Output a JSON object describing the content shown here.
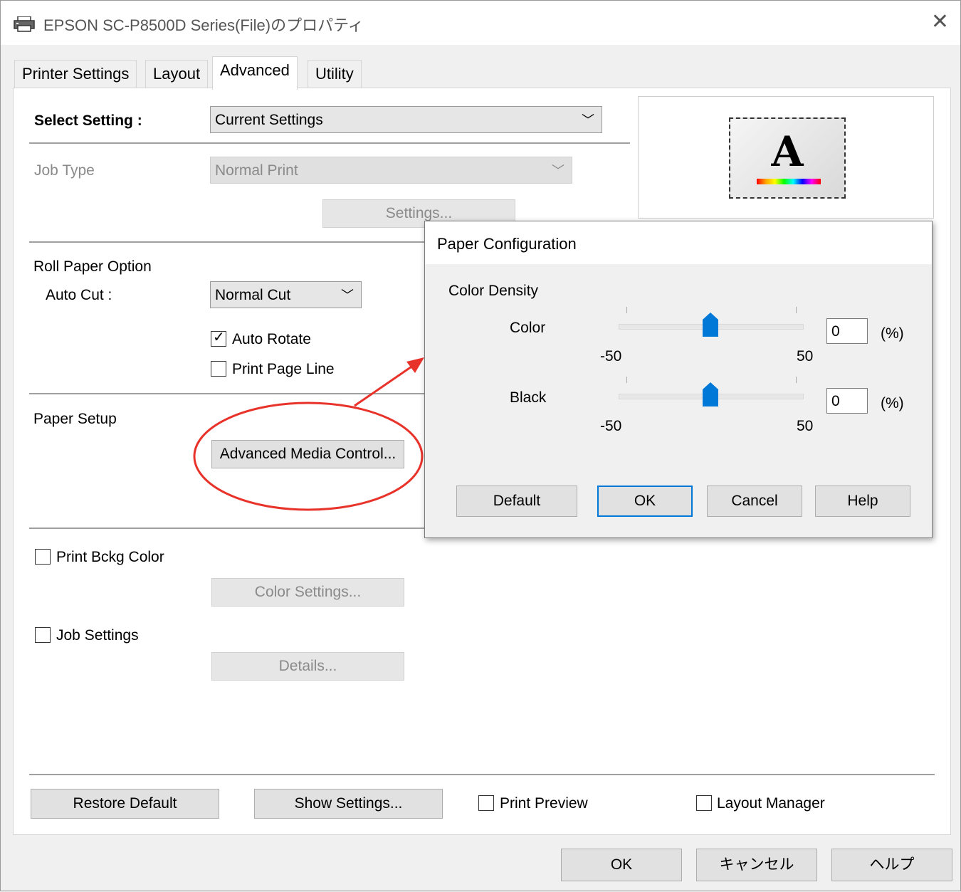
{
  "window": {
    "title": "EPSON SC-P8500D Series(File)のプロパティ",
    "close_icon": "close-icon"
  },
  "tabs": [
    {
      "label": "Printer Settings"
    },
    {
      "label": "Layout"
    },
    {
      "label": "Advanced",
      "active": true
    },
    {
      "label": "Utility"
    }
  ],
  "select_setting": {
    "label": "Select Setting :",
    "value": "Current Settings"
  },
  "job_type": {
    "label": "Job Type",
    "value": "Normal Print",
    "settings_button": "Settings..."
  },
  "roll_paper": {
    "heading": "Roll Paper Option",
    "auto_cut_label": "Auto Cut :",
    "auto_cut_value": "Normal Cut",
    "auto_rotate": {
      "label": "Auto Rotate",
      "checked": true
    },
    "print_page_line": {
      "label": "Print Page Line",
      "checked": false
    }
  },
  "paper_setup": {
    "heading": "Paper Setup",
    "button": "Advanced Media Control..."
  },
  "print_bckg_color": {
    "label": "Print Bckg Color",
    "checked": false,
    "button": "Color Settings..."
  },
  "job_settings": {
    "label": "Job Settings",
    "checked": false,
    "button": "Details..."
  },
  "bottom_row": {
    "restore_default": "Restore Default",
    "show_settings": "Show Settings...",
    "print_preview": {
      "label": "Print Preview",
      "checked": false
    },
    "layout_manager": {
      "label": "Layout Manager",
      "checked": false
    }
  },
  "footer": {
    "ok": "OK",
    "cancel": "キャンセル",
    "help": "ヘルプ"
  },
  "preview_icon": {
    "letter": "A"
  },
  "dialog": {
    "title": "Paper Configuration",
    "group": "Color Density",
    "color": {
      "label": "Color",
      "value": "0",
      "unit": "(%)",
      "min": "-50",
      "max": "50",
      "level": 0
    },
    "black": {
      "label": "Black",
      "value": "0",
      "unit": "(%)",
      "min": "-50",
      "max": "50",
      "level": 0
    },
    "buttons": {
      "default": "Default",
      "ok": "OK",
      "cancel": "Cancel",
      "help": "Help"
    }
  },
  "colors": {
    "accent": "#0078d7",
    "annotation": "#e8332a"
  }
}
